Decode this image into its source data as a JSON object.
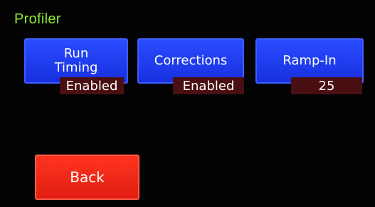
{
  "screen": {
    "title": "Profiler"
  },
  "buttons": {
    "run_timing_label": "Run\nTiming",
    "corrections_label": "Corrections",
    "ramp_in_label": "Ramp-In",
    "back_label": "Back"
  },
  "values": {
    "run_timing": "Enabled",
    "corrections": "Enabled",
    "ramp_in": "25"
  },
  "colors": {
    "title": "#8bea2d",
    "blue_button": "#1f3cff",
    "red_button": "#ff2a18",
    "value_bg": "#4a0f12",
    "background": "#030303"
  }
}
